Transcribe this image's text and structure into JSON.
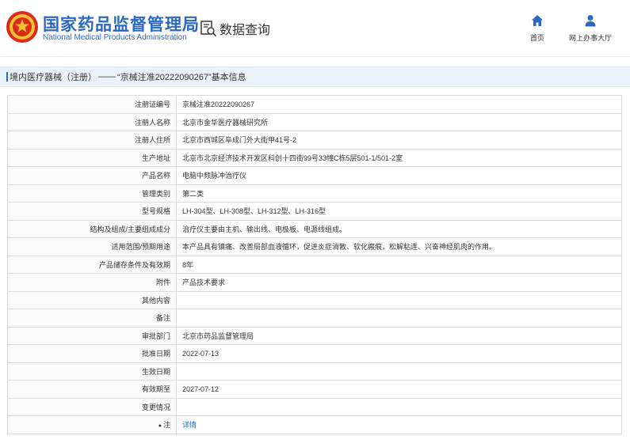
{
  "header": {
    "site_title": "国家药品监督管理局",
    "site_subtitle": "National Medical Products Administration",
    "query_label": "数据查询",
    "nav": {
      "home_label": "首页",
      "office_label": "网上办事大厅"
    },
    "brand_color": "#2a68c2",
    "icons": {
      "logo": "national-emblem-icon",
      "query": "search-document-icon",
      "home": "home-icon",
      "office": "user-icon"
    }
  },
  "section": {
    "category_link": "境内医疗器械（注册）",
    "separator": "——",
    "title": "“京械注准20222090267”基本信息"
  },
  "rows": [
    {
      "label": "注册证编号",
      "value": "京械注准20222090267"
    },
    {
      "label": "注册人名称",
      "value": "北京市金华医疗器械研究所"
    },
    {
      "label": "注册人住所",
      "value": "北京市西城区阜成门外大街甲41号-2"
    },
    {
      "label": "生产地址",
      "value": "北京市北京经济技术开发区科创十四街99号33幢C栋5层501-1/501-2室"
    },
    {
      "label": "产品名称",
      "value": "电脑中频脉冲治疗仪"
    },
    {
      "label": "管理类别",
      "value": "第二类"
    },
    {
      "label": "型号规格",
      "value": "LH-304型、LH-308型、LH-312型、LH-316型"
    },
    {
      "label": "结构及组成/主要组成成分",
      "value": "治疗仪主要由主机、输出线、电极板、电源线组成。"
    },
    {
      "label": "适用范围/预期用途",
      "value": "本产品具有镇痛、改善局部血液循环，促进炎症消散、软化瘢痕，松解粘连、兴奋神经肌肉的作用。"
    },
    {
      "label": "产品储存条件及有效期",
      "value": "8年"
    },
    {
      "label": "附件",
      "value": "产品技术要求"
    },
    {
      "label": "其他内容",
      "value": ""
    },
    {
      "label": "备注",
      "value": ""
    },
    {
      "label": "审批部门",
      "value": "北京市药品监督管理局"
    },
    {
      "label": "批准日期",
      "value": "2022-07-13"
    },
    {
      "label": "生效日期",
      "value": ""
    },
    {
      "label": "有效期至",
      "value": "2027-07-12"
    },
    {
      "label": "变更情况",
      "value": ""
    },
    {
      "label": "注",
      "value": "详情",
      "label_icon": "bullet-icon",
      "is_link": true
    }
  ]
}
